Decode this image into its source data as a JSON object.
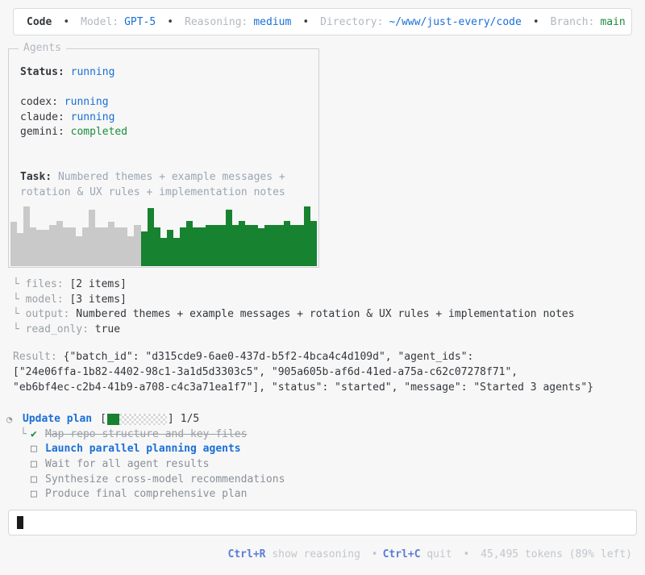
{
  "colors": {
    "page_bg": "#f7f7f7",
    "accent_blue": "#1a6fd6",
    "accent_green": "#1b8c3e",
    "bar_gray": "#c9c9c9",
    "bar_green": "#17822f",
    "muted_gray": "#9aa0a6",
    "footer_gray": "#c2c6cd",
    "footer_blue": "#5b7dd6"
  },
  "header": {
    "segments": [
      {
        "label": "",
        "value": "Code",
        "style": "app"
      },
      {
        "label": "Model:",
        "value": "GPT-5",
        "style": "blue"
      },
      {
        "label": "Reasoning:",
        "value": "medium",
        "style": "blue"
      },
      {
        "label": "Directory:",
        "value": "~/www/just-every/code",
        "style": "blue"
      },
      {
        "label": "Branch:",
        "value": "main",
        "style": "green"
      }
    ],
    "separator": "•"
  },
  "agents_panel": {
    "title": "Agents",
    "status_label": "Status:",
    "status_value": "running",
    "agents": [
      {
        "name": "codex:",
        "state": "running",
        "style": "blue"
      },
      {
        "name": "claude:",
        "state": "running",
        "style": "blue"
      },
      {
        "name": "gemini:",
        "state": "completed",
        "style": "green"
      }
    ],
    "task_label": "Task:",
    "task_text": "Numbered themes + example messages + rotation & UX rules + implementation notes"
  },
  "chart_data": {
    "type": "bar",
    "title": "agent activity sparkline",
    "ylim": [
      0,
      100
    ],
    "axes": false,
    "grid": false,
    "values": [
      70,
      52,
      95,
      62,
      58,
      58,
      66,
      72,
      62,
      62,
      48,
      62,
      90,
      62,
      62,
      70,
      62,
      62,
      48,
      66,
      55,
      92,
      62,
      45,
      58,
      45,
      62,
      72,
      62,
      62,
      66,
      66,
      66,
      90,
      66,
      72,
      66,
      66,
      60,
      66,
      66,
      66,
      72,
      66,
      66,
      95,
      72
    ],
    "segments": [
      {
        "name": "earlier-activity",
        "count": 20,
        "color": "#c9c9c9"
      },
      {
        "name": "recent-activity",
        "count": 27,
        "color": "#17822f"
      }
    ]
  },
  "tree": {
    "glyph": "└",
    "rows": [
      {
        "key": "files:",
        "value": "[2 items]"
      },
      {
        "key": "model:",
        "value": "[3 items]"
      },
      {
        "key": "output:",
        "value": "Numbered themes + example messages + rotation & UX rules + implementation notes"
      },
      {
        "key": "read_only:",
        "value": "true"
      }
    ]
  },
  "result": {
    "label": "Result: ",
    "lines": [
      "{\"batch_id\": \"d315cde9-6ae0-437d-b5f2-4bca4c4d109d\", \"agent_ids\":",
      "[\"24e06ffa-1b82-4402-98c1-3a1d5d3303c5\", \"905a605b-af6d-41ed-a75a-c62c07278f71\",",
      "\"eb6bf4ec-c2b4-41b9-a708-c4c3a71ea1f7\"], \"status\": \"started\", \"message\": \"Started 3 agents\"}"
    ]
  },
  "plan": {
    "clock_icon": "◔",
    "title": "Update plan",
    "bracket_open": "[",
    "bracket_close": "]",
    "progress": {
      "current": 1,
      "total": 5,
      "label": "1/5",
      "fraction": 0.2
    },
    "tree_glyph": "└",
    "check_glyph": "✔",
    "box_glyph": "□",
    "items": [
      {
        "state": "done",
        "label": "Map repo structure and key files"
      },
      {
        "state": "active",
        "label": "Launch parallel planning agents"
      },
      {
        "state": "pending",
        "label": "Wait for all agent results"
      },
      {
        "state": "pending",
        "label": "Synthesize cross-model recommendations"
      },
      {
        "state": "pending",
        "label": "Produce final comprehensive plan"
      }
    ]
  },
  "input": {
    "value": "",
    "placeholder": ""
  },
  "footer": {
    "shortcuts": [
      {
        "key": "Ctrl+R",
        "label": "show reasoning"
      },
      {
        "key": "Ctrl+C",
        "label": "quit"
      }
    ],
    "tokens": "45,495 tokens (89% left)",
    "separator": "•"
  }
}
